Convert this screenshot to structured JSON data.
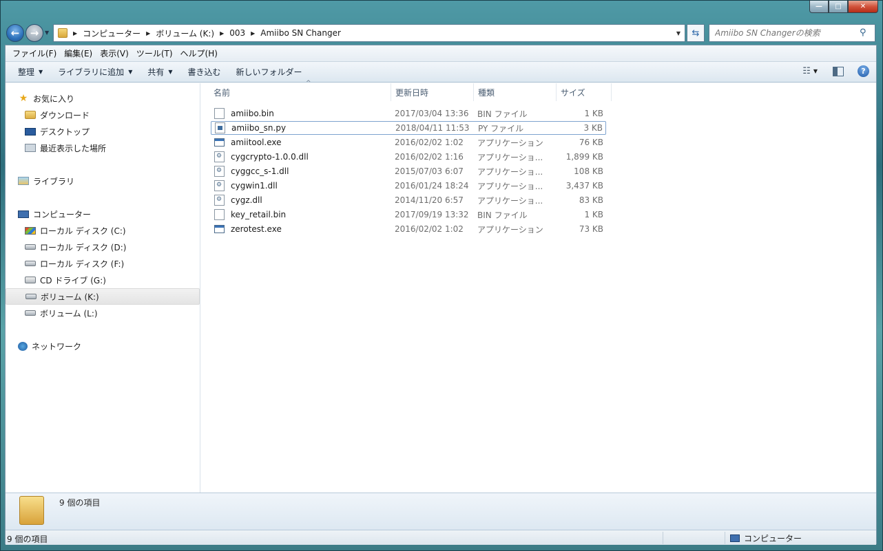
{
  "window": {
    "min_glyph": "—",
    "max_glyph": "□",
    "close_glyph": "✕"
  },
  "address": {
    "crumbs": [
      "コンピューター",
      "ボリューム (K:)",
      "003",
      "Amiibo SN Changer"
    ]
  },
  "search": {
    "placeholder": "Amiibo SN Changerの検索"
  },
  "menubar": {
    "items": [
      "ファイル(F)",
      "編集(E)",
      "表示(V)",
      "ツール(T)",
      "ヘルプ(H)"
    ]
  },
  "toolbar": {
    "organize": "整理",
    "add_to_library": "ライブラリに追加",
    "share": "共有",
    "burn": "書き込む",
    "new_folder": "新しいフォルダー"
  },
  "navpane": {
    "favorites": "お気に入り",
    "downloads": "ダウンロード",
    "desktop": "デスクトップ",
    "recent": "最近表示した場所",
    "libraries": "ライブラリ",
    "computer": "コンピューター",
    "drive_c": "ローカル ディスク (C:)",
    "drive_d": "ローカル ディスク (D:)",
    "drive_f": "ローカル ディスク (F:)",
    "drive_g": "CD ドライブ (G:)",
    "drive_k": "ボリューム (K:)",
    "drive_l": "ボリューム (L:)",
    "network": "ネットワーク"
  },
  "columns": {
    "name": "名前",
    "date": "更新日時",
    "type": "種類",
    "size": "サイズ"
  },
  "files": [
    {
      "name": "amiibo.bin",
      "date": "2017/03/04 13:36",
      "type": "BIN ファイル",
      "size": "1 KB",
      "icon": "file-icon"
    },
    {
      "name": "amiibo_sn.py",
      "date": "2018/04/11 11:53",
      "type": "PY ファイル",
      "size": "3 KB",
      "icon": "python-file-icon"
    },
    {
      "name": "amiitool.exe",
      "date": "2016/02/02 1:02",
      "type": "アプリケーション",
      "size": "76 KB",
      "icon": "exe-icon"
    },
    {
      "name": "cygcrypto-1.0.0.dll",
      "date": "2016/02/02 1:16",
      "type": "アプリケーショ...",
      "size": "1,899 KB",
      "icon": "dll-icon"
    },
    {
      "name": "cyggcc_s-1.dll",
      "date": "2015/07/03 6:07",
      "type": "アプリケーショ...",
      "size": "108 KB",
      "icon": "dll-icon"
    },
    {
      "name": "cygwin1.dll",
      "date": "2016/01/24 18:24",
      "type": "アプリケーショ...",
      "size": "3,437 KB",
      "icon": "dll-icon"
    },
    {
      "name": "cygz.dll",
      "date": "2014/11/20 6:57",
      "type": "アプリケーショ...",
      "size": "83 KB",
      "icon": "dll-icon"
    },
    {
      "name": "key_retail.bin",
      "date": "2017/09/19 13:32",
      "type": "BIN ファイル",
      "size": "1 KB",
      "icon": "file-icon"
    },
    {
      "name": "zerotest.exe",
      "date": "2016/02/02 1:02",
      "type": "アプリケーション",
      "size": "73 KB",
      "icon": "exe-icon"
    }
  ],
  "details": {
    "count_text": "9 個の項目"
  },
  "status": {
    "left": "9 個の項目",
    "right": "コンピューター"
  },
  "colors": {
    "selection_border": "#7da2ce",
    "window_chrome": "#3d7a86"
  }
}
